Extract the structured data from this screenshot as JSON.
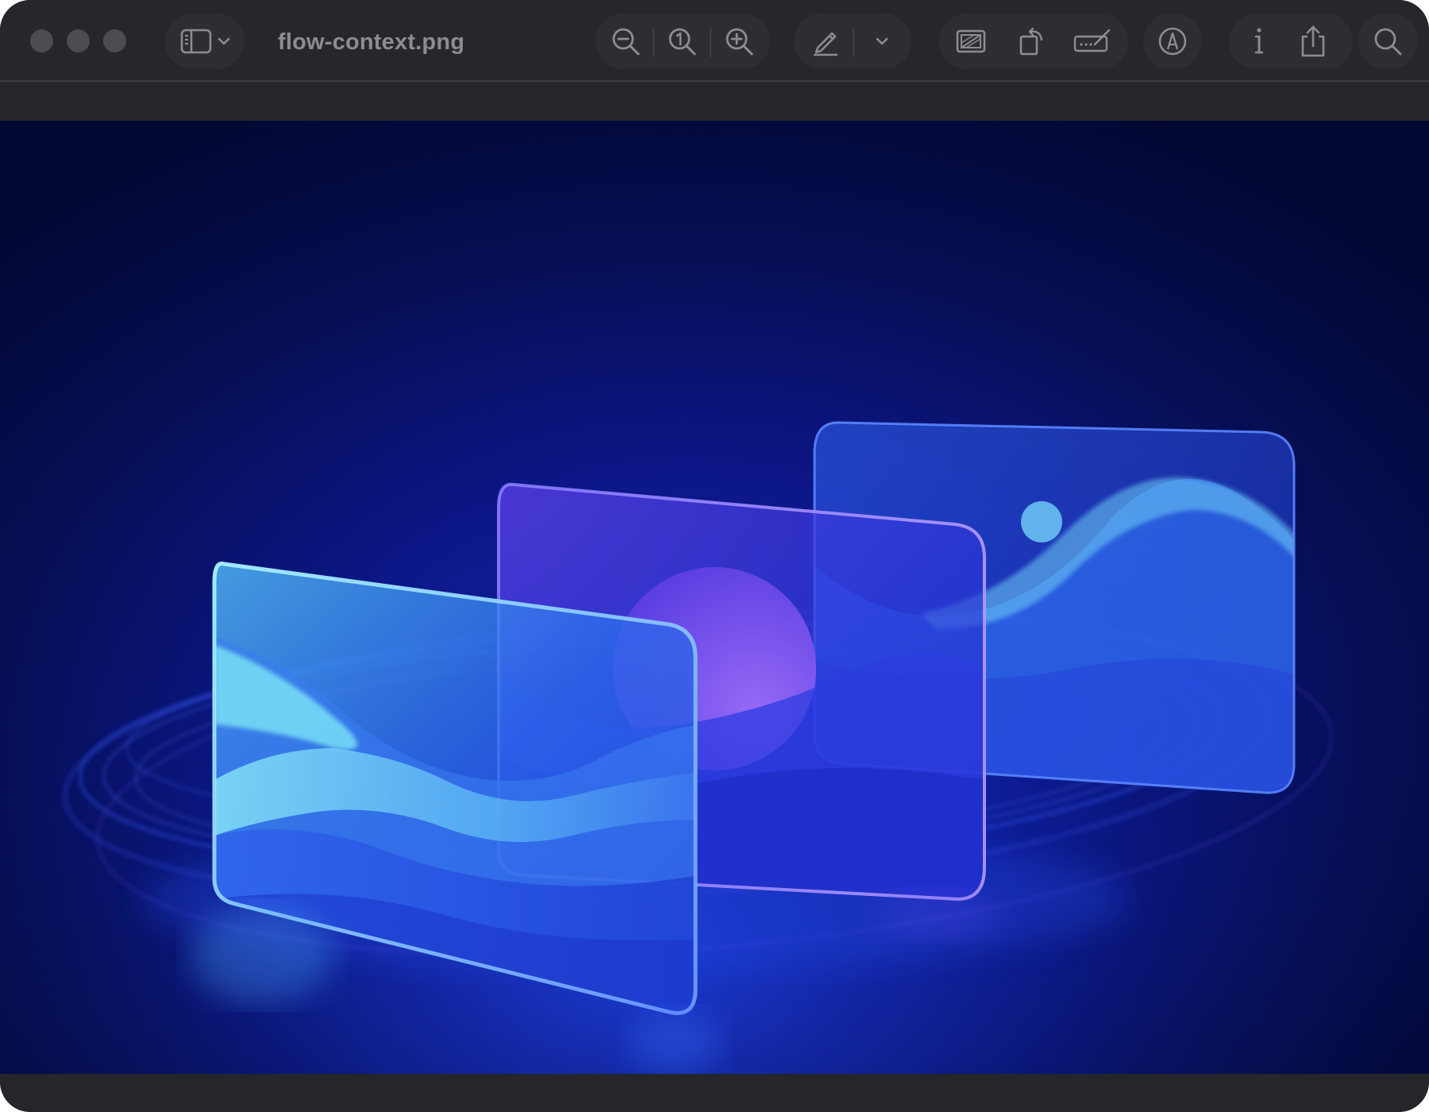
{
  "window": {
    "title": "flow-context.png"
  },
  "toolbar": {
    "traffic_lights": [
      "close",
      "minimize",
      "zoom"
    ],
    "icons": {
      "sidebar": "sidebar-icon",
      "sidebar_menu": "chevron-down-icon",
      "zoom_out": "zoom-out-icon",
      "actual_size": "actual-size-icon",
      "zoom_in": "zoom-in-icon",
      "highlight": "pencil-icon",
      "highlight_menu": "chevron-down-icon",
      "crop": "crop-icon",
      "rotate": "rotate-icon",
      "sign": "signature-icon",
      "markup": "markup-icon",
      "info": "info-icon",
      "share": "share-icon",
      "search": "search-icon"
    }
  },
  "image": {
    "background": "#040a3a",
    "accent_cyan": "#7fe9f7",
    "accent_blue": "#2f5cf0",
    "accent_violet": "#8b5cf6"
  }
}
